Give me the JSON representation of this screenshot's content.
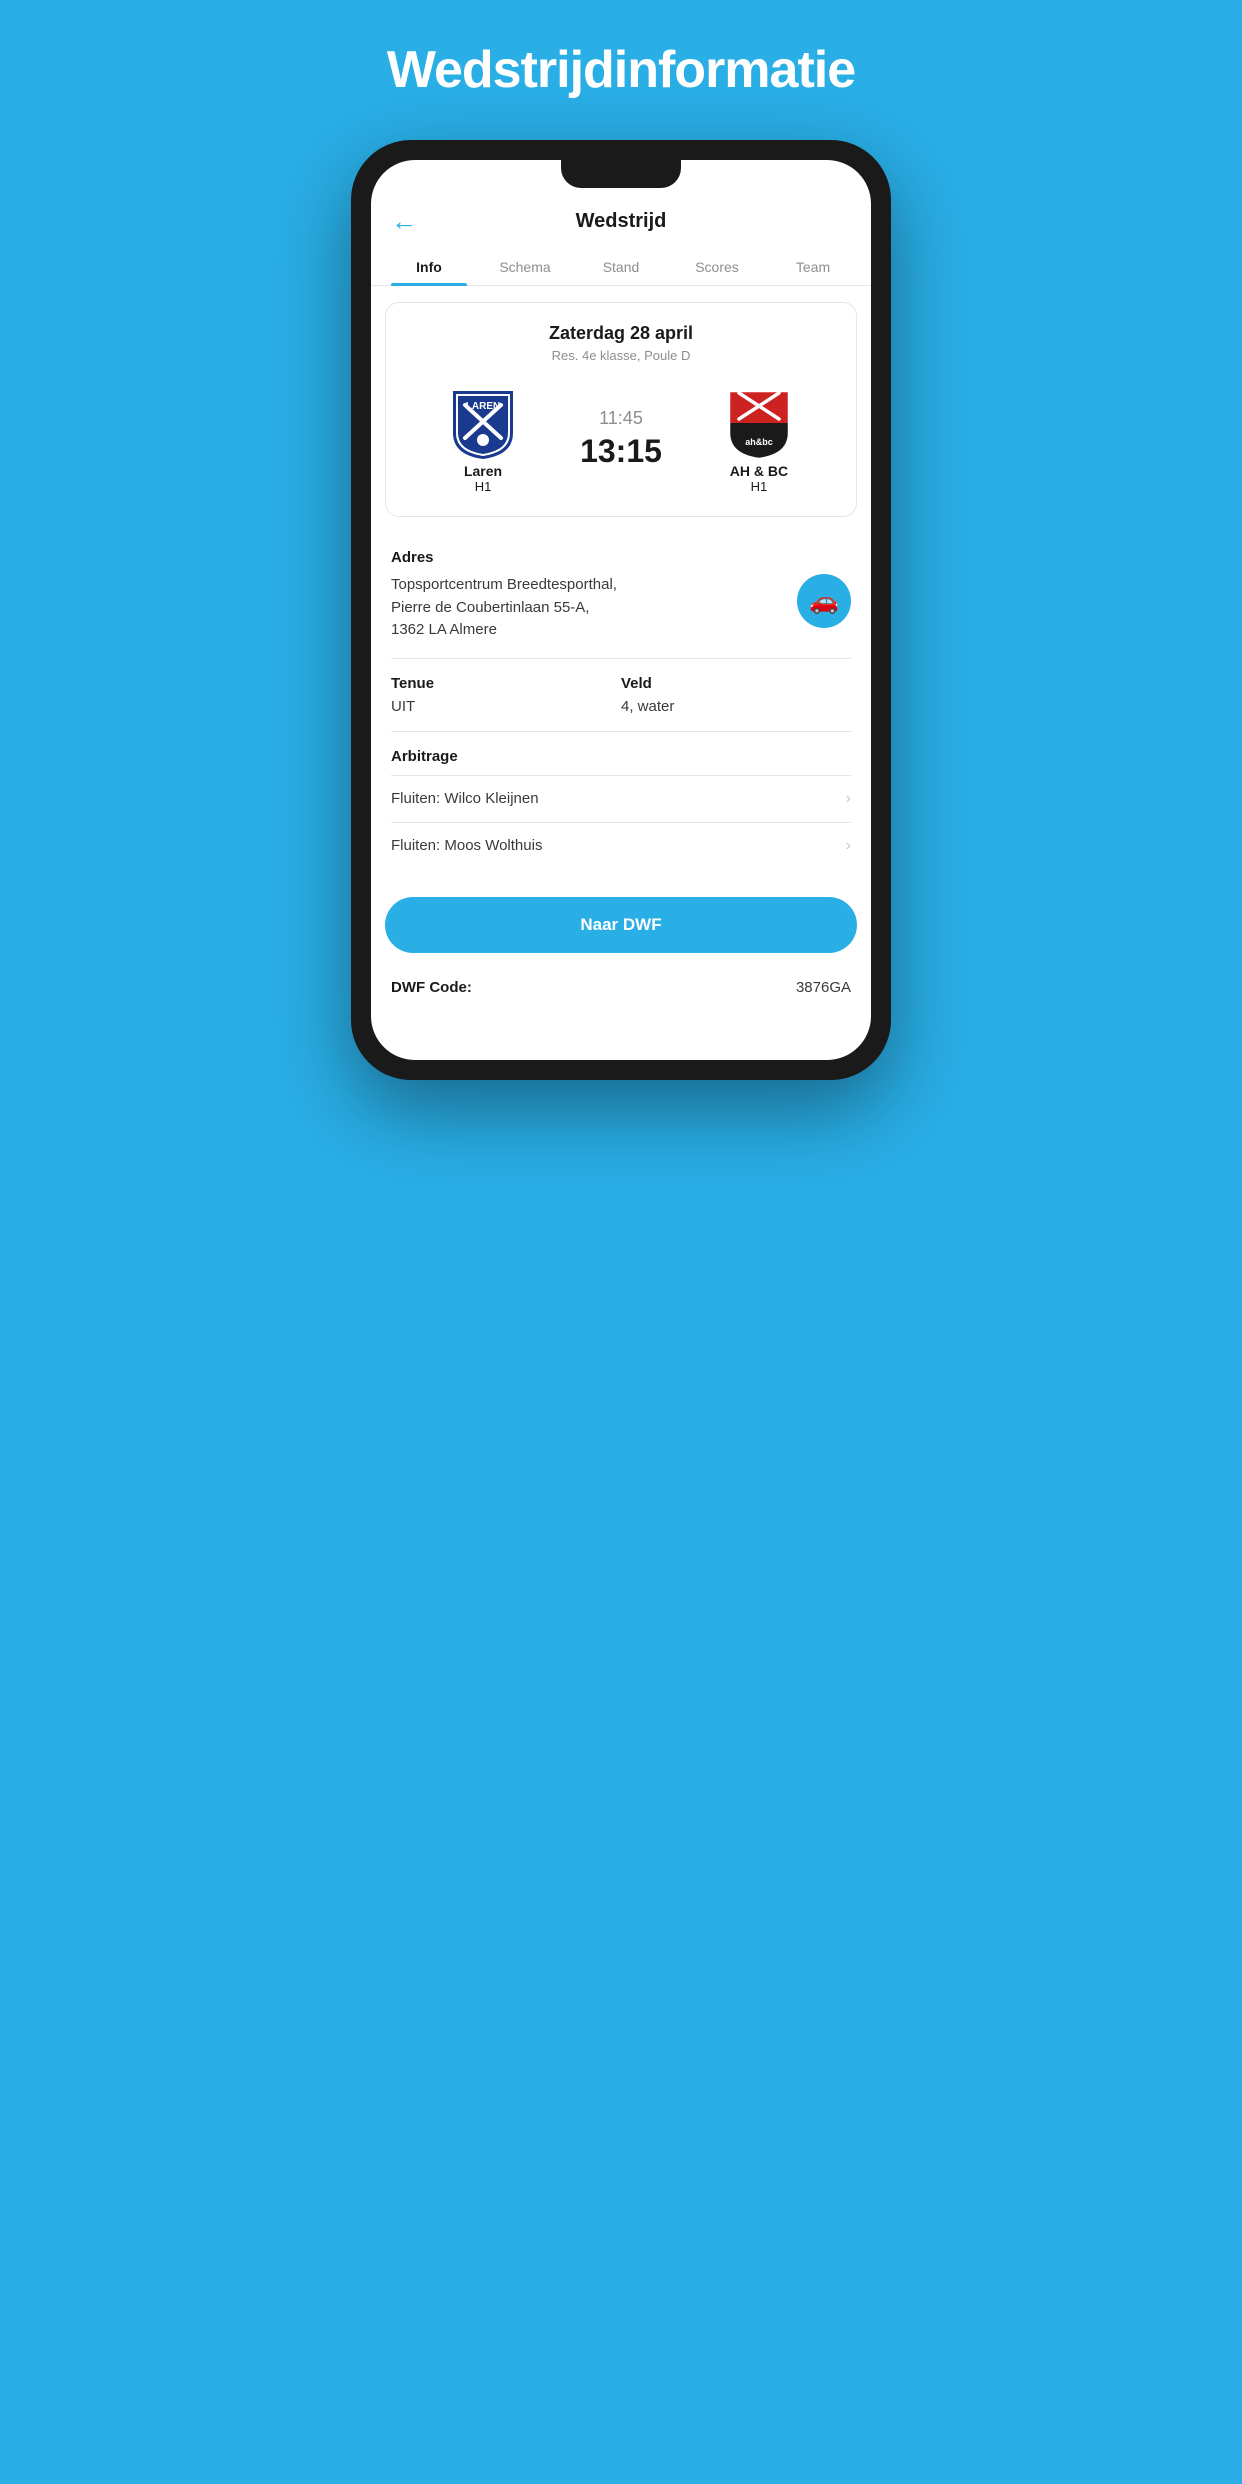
{
  "page": {
    "title": "Wedstrijdinformatie"
  },
  "header": {
    "back_icon": "←",
    "title": "Wedstrijd"
  },
  "tabs": [
    {
      "id": "info",
      "label": "Info",
      "active": true
    },
    {
      "id": "schema",
      "label": "Schema",
      "active": false
    },
    {
      "id": "stand",
      "label": "Stand",
      "active": false
    },
    {
      "id": "scores",
      "label": "Scores",
      "active": false
    },
    {
      "id": "team",
      "label": "Team",
      "active": false
    }
  ],
  "match": {
    "date": "Zaterdag 28 april",
    "league": "Res. 4e klasse, Poule D",
    "time_preliminary": "11:45",
    "time_main": "13:15",
    "home_team": {
      "name": "Laren",
      "sub": "H1"
    },
    "away_team": {
      "name": "AH & BC",
      "sub": "H1"
    }
  },
  "address": {
    "label": "Adres",
    "text_line1": "Topsportcentrum Breedtesporthal,",
    "text_line2": "Pierre de Coubertinlaan 55-A,",
    "text_line3": "1362 LA Almere"
  },
  "tenue": {
    "label": "Tenue",
    "value": "UIT"
  },
  "veld": {
    "label": "Veld",
    "value": "4, water"
  },
  "arbitrage": {
    "label": "Arbitrage",
    "items": [
      {
        "label": "Fluiten: Wilco Kleijnen"
      },
      {
        "label": "Fluiten: Moos Wolthuis"
      }
    ]
  },
  "dwf_button": {
    "label": "Naar DWF"
  },
  "dwf_code": {
    "label": "DWF Code:",
    "value": "3876GA"
  },
  "colors": {
    "primary": "#29aee6",
    "background": "#29aee6"
  }
}
